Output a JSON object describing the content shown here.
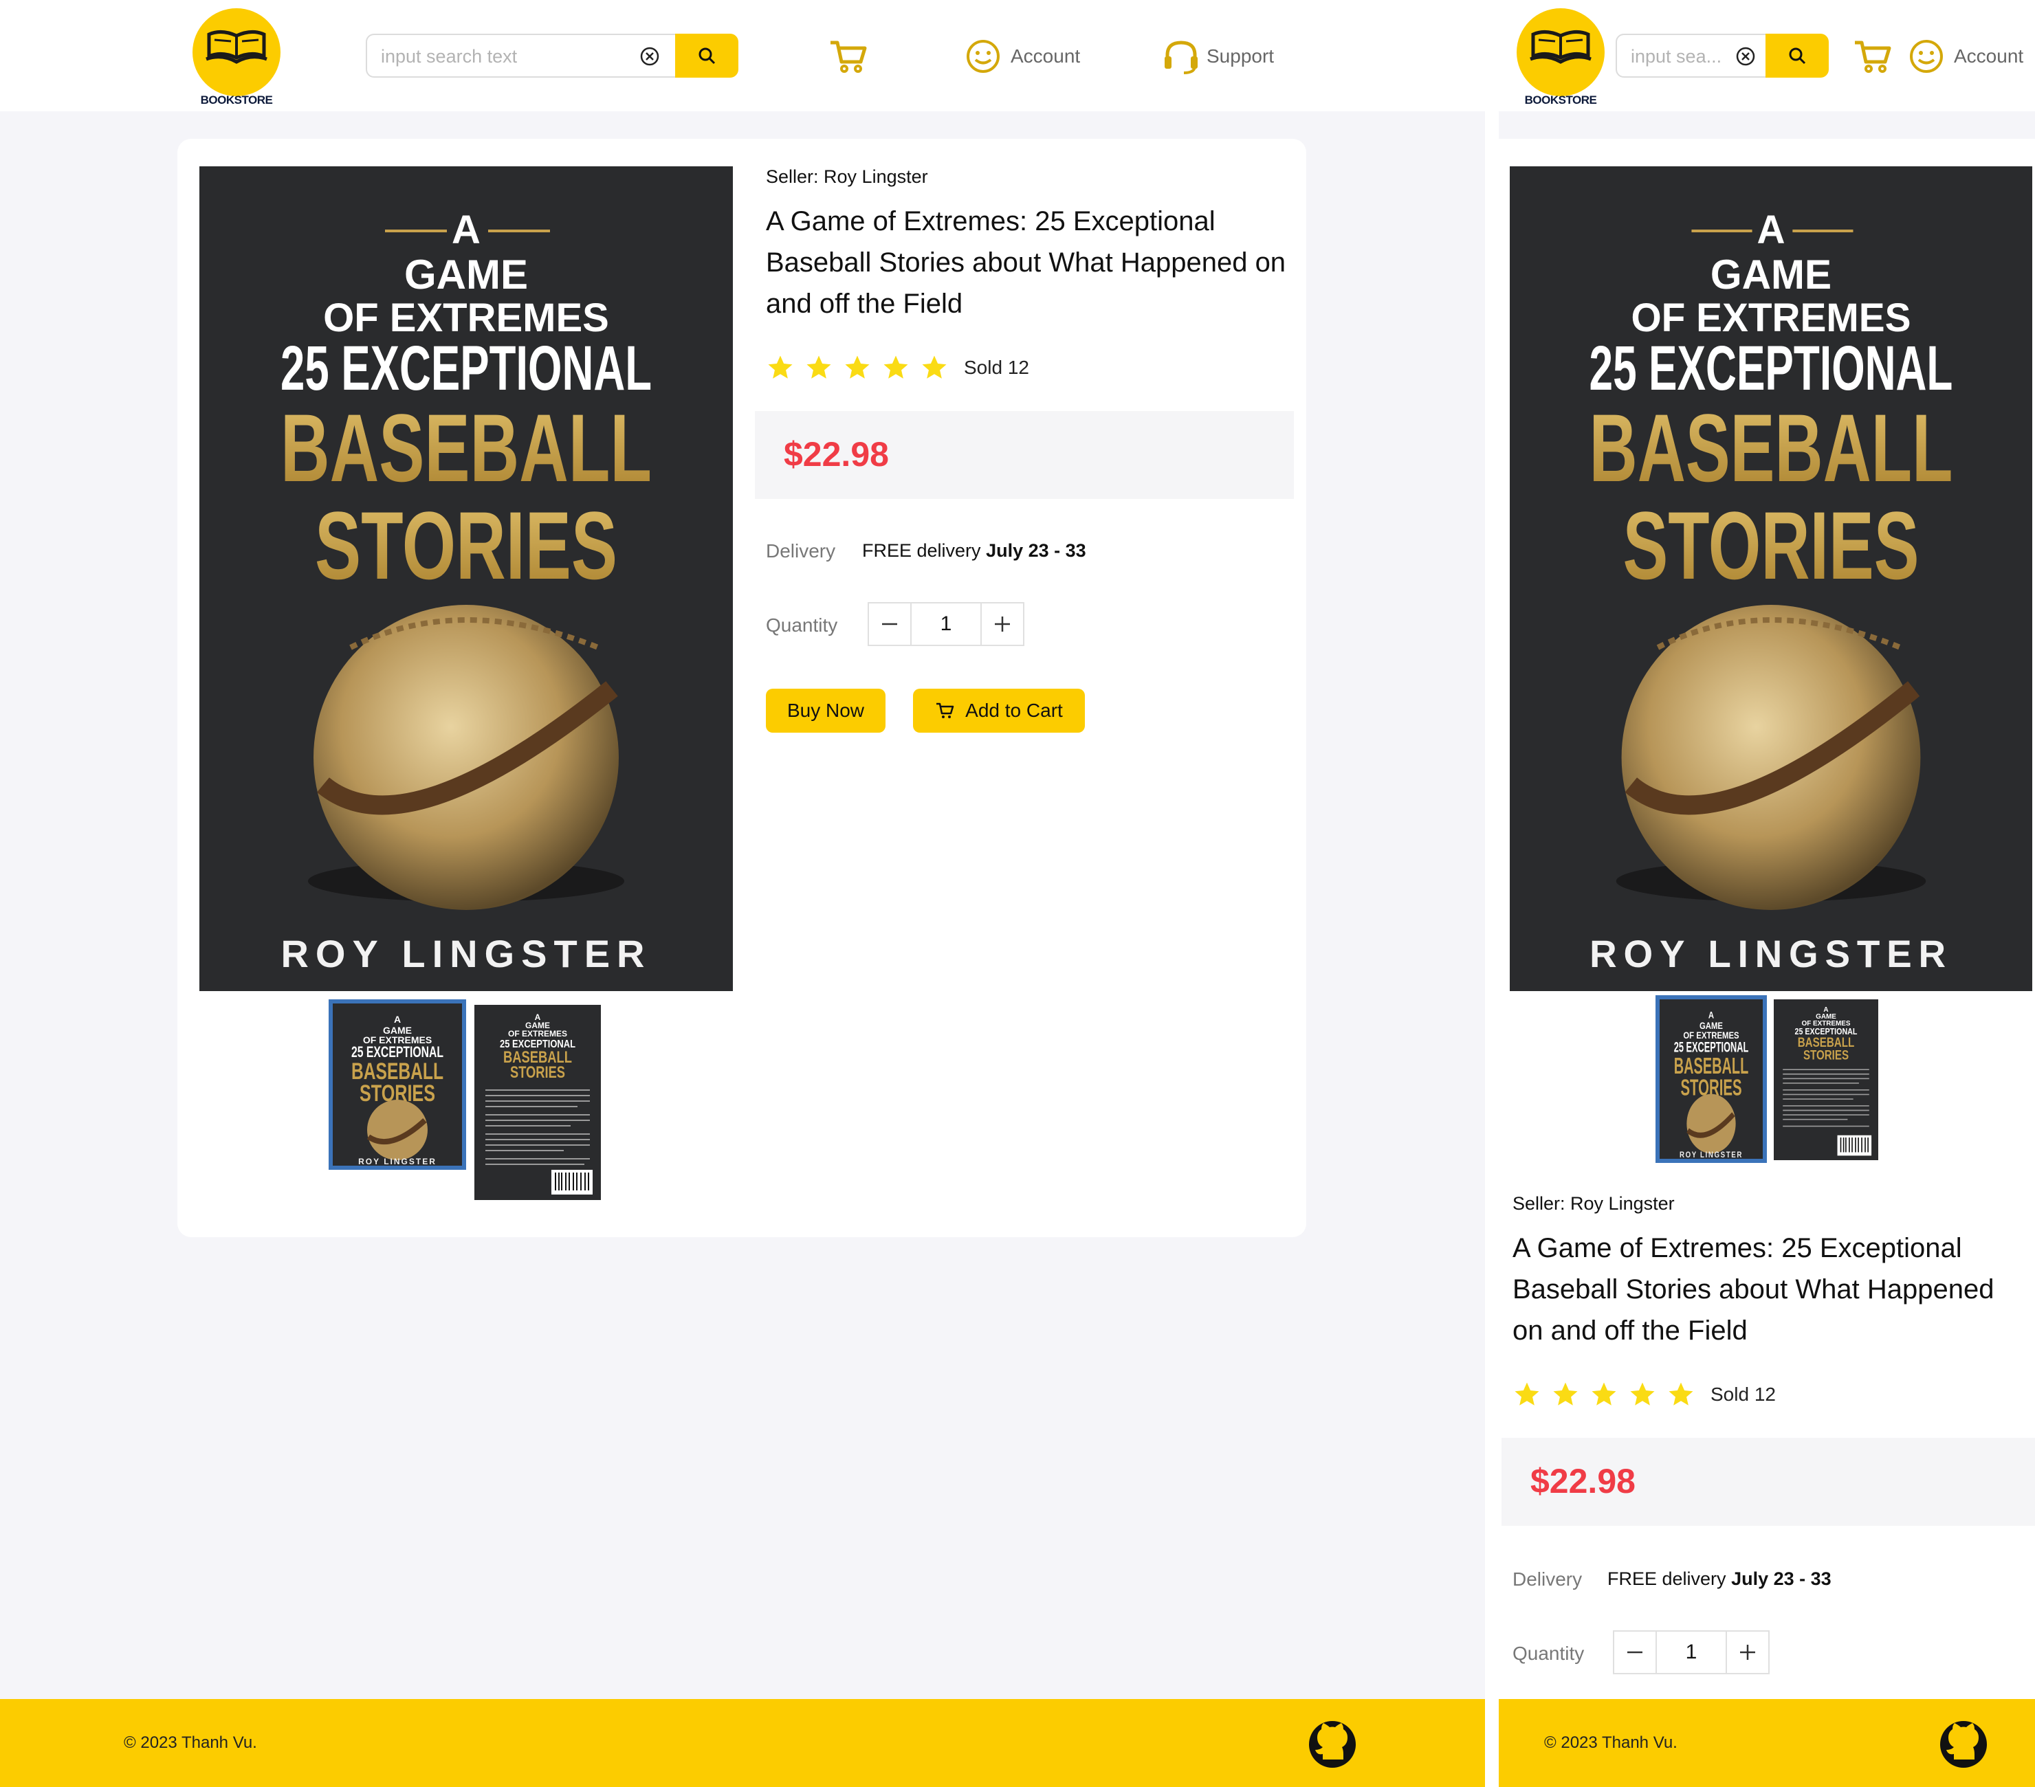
{
  "brand": {
    "logo_text": "BOOKSTORE"
  },
  "search": {
    "placeholder": "input search text",
    "placeholder_short": "input sea..."
  },
  "nav": {
    "account_label": "Account",
    "support_label": "Support"
  },
  "product": {
    "seller_label": "Seller: Roy Lingster",
    "title": "A Game of Extremes: 25 Exceptional Baseball Stories about What Happened on and off the Field",
    "rating": 5,
    "sold_label": "Sold 12",
    "price": "$22.98",
    "delivery_label": "Delivery",
    "delivery_prefix": "FREE delivery",
    "delivery_dates": "July 23 - 33",
    "quantity_label": "Quantity",
    "quantity": "1",
    "buy_now_label": "Buy Now",
    "add_to_cart_label": "Add to Cart",
    "cover": {
      "line_a": "A",
      "line_game": "GAME",
      "line_extremes": "OF EXTREMES",
      "line_25": "25 EXCEPTIONAL",
      "line_baseball": "BASEBALL",
      "line_stories": "STORIES",
      "author": "ROY LINGSTER"
    }
  },
  "footer": {
    "copyright": "© 2023 Thanh Vu."
  },
  "colors": {
    "accent": "#fccc00",
    "price": "#f03c46",
    "thumb_border": "#3b73b9",
    "page_bg": "#f5f5f9",
    "cover_bg": "#2a2b2d",
    "cover_gold": "#c9a24c"
  }
}
